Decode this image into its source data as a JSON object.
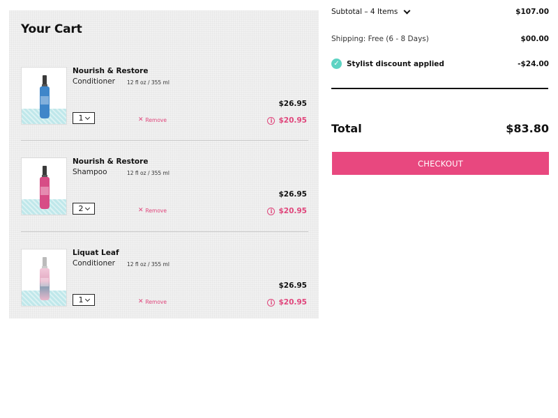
{
  "cart": {
    "title": "Your Cart",
    "items": [
      {
        "name": "Nourish & Restore",
        "subname": "Conditioner",
        "size": "12 fl oz / 355 ml",
        "qty": "1",
        "remove_label": "Remove",
        "price_original": "$26.95",
        "price_sale": "$20.95",
        "bottle_color": "#3f86c9"
      },
      {
        "name": "Nourish & Restore",
        "subname": "Shampoo",
        "size": "12 fl oz / 355 ml",
        "qty": "2",
        "remove_label": "Remove",
        "price_original": "$26.95",
        "price_sale": "$20.95",
        "bottle_color": "#d74d86"
      },
      {
        "name": "Liquat Leaf",
        "subname": "Conditioner",
        "size": "12 fl oz / 355 ml",
        "qty": "1",
        "remove_label": "Remove",
        "price_original": "$26.95",
        "price_sale": "$20.95",
        "bottle_color": "#e3a9c2"
      }
    ]
  },
  "summary": {
    "subtotal_label": "Subtotal – 4 Items",
    "subtotal_value": "$107.00",
    "shipping_label": "Shipping: Free (6 - 8 Days)",
    "shipping_value": "$00.00",
    "discount_label": "Stylist discount applied",
    "discount_value": "-$24.00",
    "total_label": "Total",
    "total_value": "$83.80",
    "checkout_label": "CHECKOUT"
  },
  "colors": {
    "accent": "#e8487f",
    "check": "#5ed3c3",
    "panel_bg": "#f1f1f1"
  }
}
